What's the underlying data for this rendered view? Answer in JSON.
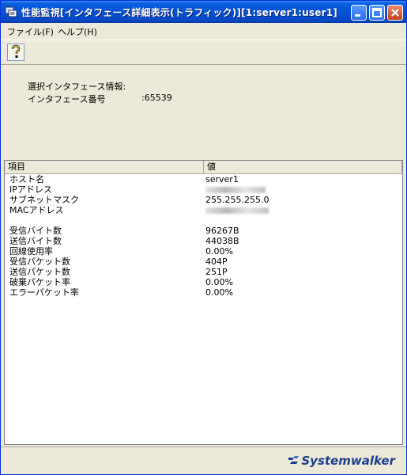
{
  "window": {
    "title": "性能監視[インタフェース詳細表示(トラフィック)][1:server1:user1]"
  },
  "menu": [
    {
      "label": "ファイル(F)"
    },
    {
      "label": "ヘルプ(H)"
    }
  ],
  "info": {
    "heading": "選択インタフェース情報:",
    "label": "インタフェース番号",
    "value": ":65539"
  },
  "table": {
    "columns": [
      "項目",
      "値"
    ],
    "rows": [
      {
        "item": "ホスト名",
        "value": "server1"
      },
      {
        "item": "IPアドレス",
        "value": "",
        "redacted": true
      },
      {
        "item": "サブネットマスク",
        "value": "255.255.255.0"
      },
      {
        "item": "MACアドレス",
        "value": "",
        "redacted": true
      },
      {
        "item": "",
        "value": ""
      },
      {
        "item": "受信バイト数",
        "value": "96267B"
      },
      {
        "item": "送信バイト数",
        "value": "44038B"
      },
      {
        "item": "回線使用率",
        "value": "0.00%"
      },
      {
        "item": "受信パケット数",
        "value": "404P"
      },
      {
        "item": "送信パケット数",
        "value": "251P"
      },
      {
        "item": "破棄パケット率",
        "value": "0.00%"
      },
      {
        "item": "エラーパケット率",
        "value": "0.00%"
      }
    ]
  },
  "branding": {
    "logo_text": "Systemwalker"
  },
  "icons": [
    "app-icon",
    "minimize-icon",
    "maximize-icon",
    "close-icon",
    "help-icon",
    "systemwalker-logo-icon"
  ],
  "colors": {
    "titlebar": "#0453d6",
    "window_bg": "#ece9d8",
    "logo": "#1a3f8c"
  }
}
